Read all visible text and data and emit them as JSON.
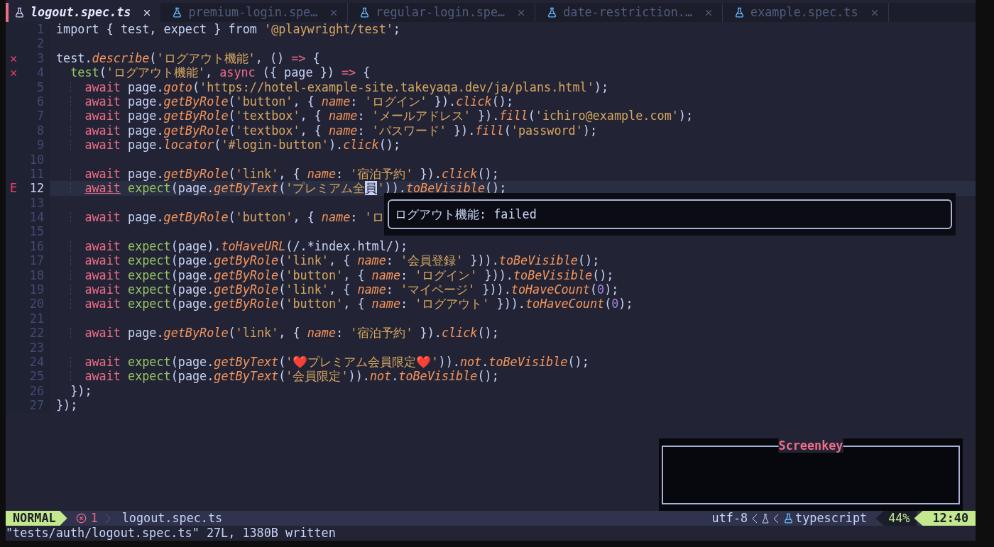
{
  "tabs": [
    {
      "label": "logout.spec.ts",
      "selected": true
    },
    {
      "label": "premium-login.spe…",
      "selected": false
    },
    {
      "label": "regular-login.spe…",
      "selected": false
    },
    {
      "label": "date-restriction.…",
      "selected": false
    },
    {
      "label": "example.spec.ts",
      "selected": false
    }
  ],
  "editor": {
    "lines": [
      {
        "n": "1",
        "tokens": [
          {
            "text": "import { test, expect } from ",
            "kind": "plain"
          },
          {
            "text": "'@playwright/test'",
            "kind": "string"
          },
          {
            "text": ";",
            "kind": "plain"
          }
        ]
      },
      {
        "n": "2"
      },
      {
        "n": "3",
        "sign": "✕",
        "tokens": [
          {
            "text": "test.",
            "kind": "plain"
          },
          {
            "text": "describe",
            "kind": "method"
          },
          {
            "text": "(",
            "kind": "plain"
          },
          {
            "text": "'ログアウト機能'",
            "kind": "string"
          },
          {
            "text": ", () ",
            "kind": "plain"
          },
          {
            "text": "=>",
            "kind": "keyword"
          },
          {
            "text": " {",
            "kind": "plain"
          }
        ]
      },
      {
        "n": "4",
        "sign": "✕",
        "tokens": [
          {
            "text": "  test",
            "kind": "call"
          },
          {
            "text": "(",
            "kind": "plain"
          },
          {
            "text": "'ログアウト機能'",
            "kind": "string"
          },
          {
            "text": ", ",
            "kind": "plain"
          },
          {
            "text": "async",
            "kind": "keyword"
          },
          {
            "text": " ({ page }) ",
            "kind": "plain"
          },
          {
            "text": "=>",
            "kind": "keyword"
          },
          {
            "text": " {",
            "kind": "plain"
          }
        ]
      },
      {
        "n": "5",
        "guide": true,
        "tokens": [
          {
            "text": "await",
            "kind": "keyword"
          },
          {
            "text": " page.",
            "kind": "plain"
          },
          {
            "text": "goto",
            "kind": "method"
          },
          {
            "text": "(",
            "kind": "plain"
          },
          {
            "text": "'https://hotel-example-site.takeyaqa.dev/ja/plans.html'",
            "kind": "string"
          },
          {
            "text": ");",
            "kind": "plain"
          }
        ]
      },
      {
        "n": "6",
        "guide": true,
        "tokens": [
          {
            "text": "await",
            "kind": "keyword"
          },
          {
            "text": " page.",
            "kind": "plain"
          },
          {
            "text": "getByRole",
            "kind": "method"
          },
          {
            "text": "(",
            "kind": "plain"
          },
          {
            "text": "'button'",
            "kind": "string"
          },
          {
            "text": ", { ",
            "kind": "plain"
          },
          {
            "text": "name",
            "kind": "method"
          },
          {
            "text": ": ",
            "kind": "plain"
          },
          {
            "text": "'ログイン'",
            "kind": "string"
          },
          {
            "text": " }).",
            "kind": "plain"
          },
          {
            "text": "click",
            "kind": "method"
          },
          {
            "text": "();",
            "kind": "plain"
          }
        ]
      },
      {
        "n": "7",
        "guide": true,
        "tokens": [
          {
            "text": "await",
            "kind": "keyword"
          },
          {
            "text": " page.",
            "kind": "plain"
          },
          {
            "text": "getByRole",
            "kind": "method"
          },
          {
            "text": "(",
            "kind": "plain"
          },
          {
            "text": "'textbox'",
            "kind": "string"
          },
          {
            "text": ", { ",
            "kind": "plain"
          },
          {
            "text": "name",
            "kind": "method"
          },
          {
            "text": ": ",
            "kind": "plain"
          },
          {
            "text": "'メールアドレス'",
            "kind": "string"
          },
          {
            "text": " }).",
            "kind": "plain"
          },
          {
            "text": "fill",
            "kind": "method"
          },
          {
            "text": "(",
            "kind": "plain"
          },
          {
            "text": "'ichiro@example.com'",
            "kind": "string"
          },
          {
            "text": ");",
            "kind": "plain"
          }
        ]
      },
      {
        "n": "8",
        "guide": true,
        "tokens": [
          {
            "text": "await",
            "kind": "keyword"
          },
          {
            "text": " page.",
            "kind": "plain"
          },
          {
            "text": "getByRole",
            "kind": "method"
          },
          {
            "text": "(",
            "kind": "plain"
          },
          {
            "text": "'textbox'",
            "kind": "string"
          },
          {
            "text": ", { ",
            "kind": "plain"
          },
          {
            "text": "name",
            "kind": "method"
          },
          {
            "text": ": ",
            "kind": "plain"
          },
          {
            "text": "'パスワード'",
            "kind": "string"
          },
          {
            "text": " }).",
            "kind": "plain"
          },
          {
            "text": "fill",
            "kind": "method"
          },
          {
            "text": "(",
            "kind": "plain"
          },
          {
            "text": "'password'",
            "kind": "string"
          },
          {
            "text": ");",
            "kind": "plain"
          }
        ]
      },
      {
        "n": "9",
        "guide": true,
        "tokens": [
          {
            "text": "await",
            "kind": "keyword"
          },
          {
            "text": " page.",
            "kind": "plain"
          },
          {
            "text": "locator",
            "kind": "method"
          },
          {
            "text": "(",
            "kind": "plain"
          },
          {
            "text": "'#login-button'",
            "kind": "string"
          },
          {
            "text": ").",
            "kind": "plain"
          },
          {
            "text": "click",
            "kind": "method"
          },
          {
            "text": "();",
            "kind": "plain"
          }
        ]
      },
      {
        "n": "10"
      },
      {
        "n": "11",
        "guide": true,
        "tokens": [
          {
            "text": "await",
            "kind": "keyword"
          },
          {
            "text": " page.",
            "kind": "plain"
          },
          {
            "text": "getByRole",
            "kind": "method"
          },
          {
            "text": "(",
            "kind": "plain"
          },
          {
            "text": "'link'",
            "kind": "string"
          },
          {
            "text": ", { ",
            "kind": "plain"
          },
          {
            "text": "name",
            "kind": "method"
          },
          {
            "text": ": ",
            "kind": "plain"
          },
          {
            "text": "'宿泊予約'",
            "kind": "string"
          },
          {
            "text": " }).",
            "kind": "plain"
          },
          {
            "text": "click",
            "kind": "method"
          },
          {
            "text": "();",
            "kind": "plain"
          }
        ]
      },
      {
        "n": "12",
        "sign": "E",
        "current": true,
        "guide": true,
        "tokens": [
          {
            "text": "await",
            "kind": "underlined"
          },
          {
            "text": " expect",
            "kind": "call"
          },
          {
            "text": "(page.",
            "kind": "plain"
          },
          {
            "text": "getByText",
            "kind": "method"
          },
          {
            "text": "(",
            "kind": "plain"
          },
          {
            "text": "'プレミアム全",
            "kind": "string"
          },
          {
            "text": "員",
            "kind": "cursor"
          },
          {
            "text": "'",
            "kind": "string"
          },
          {
            "text": ")).",
            "kind": "plain"
          },
          {
            "text": "toBeVisible",
            "kind": "method"
          },
          {
            "text": "();",
            "kind": "plain"
          }
        ]
      },
      {
        "n": "13"
      },
      {
        "n": "14",
        "guide": true,
        "tokens": [
          {
            "text": "await",
            "kind": "keyword"
          },
          {
            "text": " page.",
            "kind": "plain"
          },
          {
            "text": "getByRole",
            "kind": "method"
          },
          {
            "text": "(",
            "kind": "plain"
          },
          {
            "text": "'button'",
            "kind": "string"
          },
          {
            "text": ", { ",
            "kind": "plain"
          },
          {
            "text": "name",
            "kind": "method"
          },
          {
            "text": ": ",
            "kind": "plain"
          },
          {
            "text": "'ロ",
            "kind": "string"
          }
        ]
      },
      {
        "n": "15"
      },
      {
        "n": "16",
        "guide": true,
        "tokens": [
          {
            "text": "await",
            "kind": "keyword"
          },
          {
            "text": " expect",
            "kind": "call"
          },
          {
            "text": "(page).",
            "kind": "plain"
          },
          {
            "text": "toHaveURL",
            "kind": "method"
          },
          {
            "text": "(/.*index.html/);",
            "kind": "plain"
          }
        ]
      },
      {
        "n": "17",
        "guide": true,
        "tokens": [
          {
            "text": "await",
            "kind": "keyword"
          },
          {
            "text": " expect",
            "kind": "call"
          },
          {
            "text": "(page.",
            "kind": "plain"
          },
          {
            "text": "getByRole",
            "kind": "method"
          },
          {
            "text": "(",
            "kind": "plain"
          },
          {
            "text": "'link'",
            "kind": "string"
          },
          {
            "text": ", { ",
            "kind": "plain"
          },
          {
            "text": "name",
            "kind": "method"
          },
          {
            "text": ": ",
            "kind": "plain"
          },
          {
            "text": "'会員登録'",
            "kind": "string"
          },
          {
            "text": " })).",
            "kind": "plain"
          },
          {
            "text": "toBeVisible",
            "kind": "method"
          },
          {
            "text": "();",
            "kind": "plain"
          }
        ]
      },
      {
        "n": "18",
        "guide": true,
        "tokens": [
          {
            "text": "await",
            "kind": "keyword"
          },
          {
            "text": " expect",
            "kind": "call"
          },
          {
            "text": "(page.",
            "kind": "plain"
          },
          {
            "text": "getByRole",
            "kind": "method"
          },
          {
            "text": "(",
            "kind": "plain"
          },
          {
            "text": "'button'",
            "kind": "string"
          },
          {
            "text": ", { ",
            "kind": "plain"
          },
          {
            "text": "name",
            "kind": "method"
          },
          {
            "text": ": ",
            "kind": "plain"
          },
          {
            "text": "'ログイン'",
            "kind": "string"
          },
          {
            "text": " })).",
            "kind": "plain"
          },
          {
            "text": "toBeVisible",
            "kind": "method"
          },
          {
            "text": "();",
            "kind": "plain"
          }
        ]
      },
      {
        "n": "19",
        "guide": true,
        "tokens": [
          {
            "text": "await",
            "kind": "keyword"
          },
          {
            "text": " expect",
            "kind": "call"
          },
          {
            "text": "(page.",
            "kind": "plain"
          },
          {
            "text": "getByRole",
            "kind": "method"
          },
          {
            "text": "(",
            "kind": "plain"
          },
          {
            "text": "'link'",
            "kind": "string"
          },
          {
            "text": ", { ",
            "kind": "plain"
          },
          {
            "text": "name",
            "kind": "method"
          },
          {
            "text": ": ",
            "kind": "plain"
          },
          {
            "text": "'マイページ'",
            "kind": "string"
          },
          {
            "text": " })).",
            "kind": "plain"
          },
          {
            "text": "toHaveCount",
            "kind": "method"
          },
          {
            "text": "(",
            "kind": "plain"
          },
          {
            "text": "0",
            "kind": "number"
          },
          {
            "text": ");",
            "kind": "plain"
          }
        ]
      },
      {
        "n": "20",
        "guide": true,
        "tokens": [
          {
            "text": "await",
            "kind": "keyword"
          },
          {
            "text": " expect",
            "kind": "call"
          },
          {
            "text": "(page.",
            "kind": "plain"
          },
          {
            "text": "getByRole",
            "kind": "method"
          },
          {
            "text": "(",
            "kind": "plain"
          },
          {
            "text": "'button'",
            "kind": "string"
          },
          {
            "text": ", { ",
            "kind": "plain"
          },
          {
            "text": "name",
            "kind": "method"
          },
          {
            "text": ": ",
            "kind": "plain"
          },
          {
            "text": "'ログアウト'",
            "kind": "string"
          },
          {
            "text": " })).",
            "kind": "plain"
          },
          {
            "text": "toHaveCount",
            "kind": "method"
          },
          {
            "text": "(",
            "kind": "plain"
          },
          {
            "text": "0",
            "kind": "number"
          },
          {
            "text": ");",
            "kind": "plain"
          }
        ]
      },
      {
        "n": "21"
      },
      {
        "n": "22",
        "guide": true,
        "tokens": [
          {
            "text": "await",
            "kind": "keyword"
          },
          {
            "text": " page.",
            "kind": "plain"
          },
          {
            "text": "getByRole",
            "kind": "method"
          },
          {
            "text": "(",
            "kind": "plain"
          },
          {
            "text": "'link'",
            "kind": "string"
          },
          {
            "text": ", { ",
            "kind": "plain"
          },
          {
            "text": "name",
            "kind": "method"
          },
          {
            "text": ": ",
            "kind": "plain"
          },
          {
            "text": "'宿泊予約'",
            "kind": "string"
          },
          {
            "text": " }).",
            "kind": "plain"
          },
          {
            "text": "click",
            "kind": "method"
          },
          {
            "text": "();",
            "kind": "plain"
          }
        ]
      },
      {
        "n": "23"
      },
      {
        "n": "24",
        "guide": true,
        "tokens": [
          {
            "text": "await",
            "kind": "keyword"
          },
          {
            "text": " expect",
            "kind": "call"
          },
          {
            "text": "(page.",
            "kind": "plain"
          },
          {
            "text": "getByText",
            "kind": "method"
          },
          {
            "text": "(",
            "kind": "plain"
          },
          {
            "text": "'❤️プレミアム会員限定❤️'",
            "kind": "string"
          },
          {
            "text": ")).",
            "kind": "plain"
          },
          {
            "text": "not",
            "kind": "method"
          },
          {
            "text": ".",
            "kind": "plain"
          },
          {
            "text": "toBeVisible",
            "kind": "method"
          },
          {
            "text": "();",
            "kind": "plain"
          }
        ]
      },
      {
        "n": "25",
        "guide": true,
        "tokens": [
          {
            "text": "await",
            "kind": "keyword"
          },
          {
            "text": " expect",
            "kind": "call"
          },
          {
            "text": "(page.",
            "kind": "plain"
          },
          {
            "text": "getByText",
            "kind": "method"
          },
          {
            "text": "(",
            "kind": "plain"
          },
          {
            "text": "'会員限定'",
            "kind": "string"
          },
          {
            "text": ")).",
            "kind": "plain"
          },
          {
            "text": "not",
            "kind": "method"
          },
          {
            "text": ".",
            "kind": "plain"
          },
          {
            "text": "toBeVisible",
            "kind": "method"
          },
          {
            "text": "();",
            "kind": "plain"
          }
        ]
      },
      {
        "n": "26",
        "tokens": [
          {
            "text": "  });",
            "kind": "plain"
          }
        ]
      },
      {
        "n": "27",
        "tokens": [
          {
            "text": "});",
            "kind": "plain"
          }
        ]
      }
    ]
  },
  "popup": {
    "text": "ログアウト機能: failed"
  },
  "screenkey": {
    "title": "Screenkey"
  },
  "status_bar": {
    "mode": "NORMAL",
    "errors": "1",
    "file": "logout.spec.ts",
    "encoding": "utf-8",
    "filetype": "typescript",
    "percent": "44%",
    "position": "12:40"
  },
  "message": "\"tests/auth/logout.spec.ts\" 27L, 1380B written"
}
